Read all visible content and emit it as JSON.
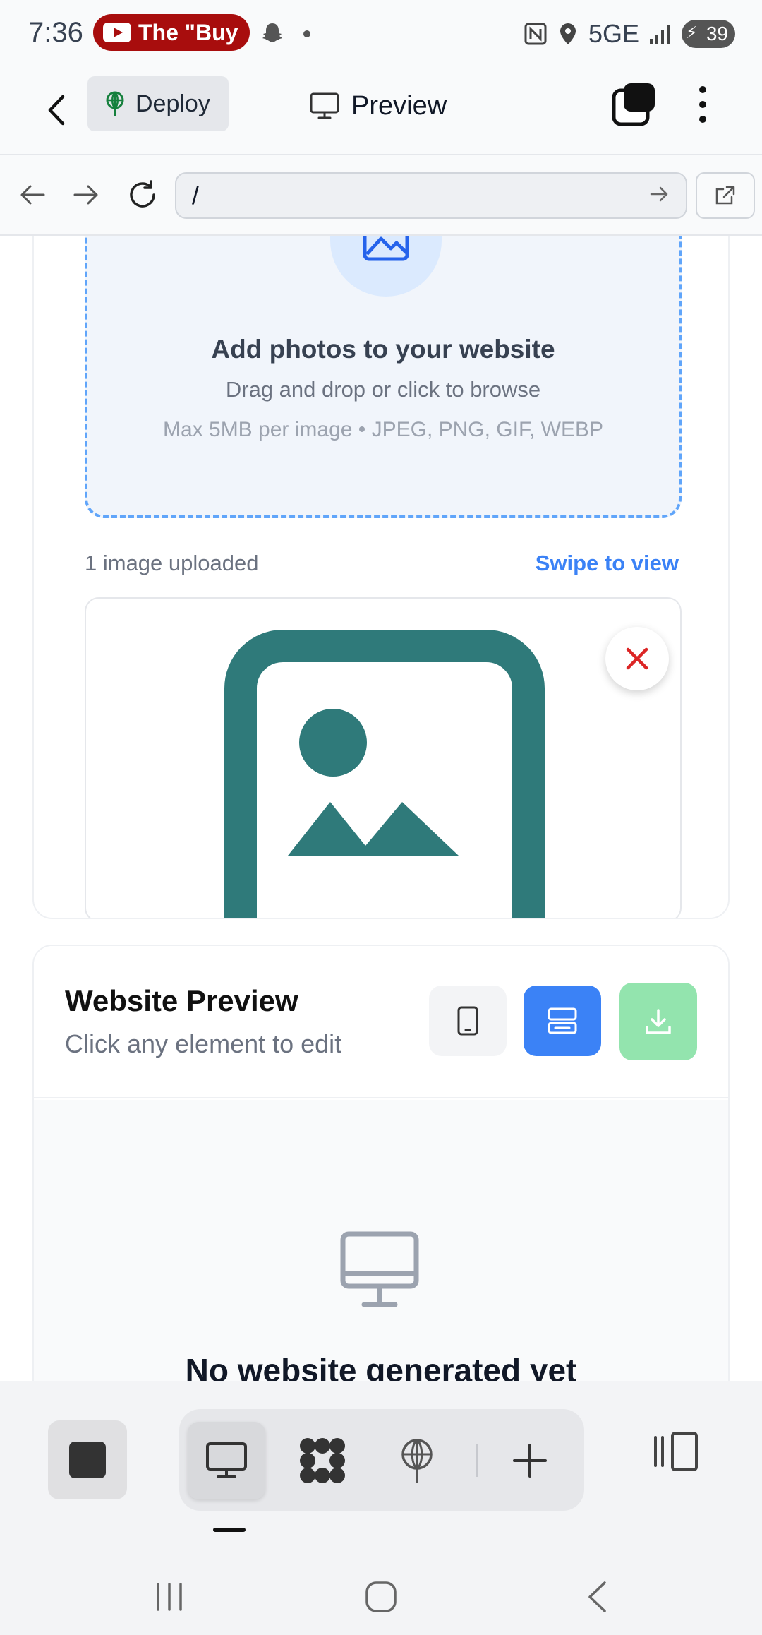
{
  "status_bar": {
    "time": "7:36",
    "notification_text": "The \"Buy",
    "network": "5GE",
    "battery": "39"
  },
  "header": {
    "deploy_label": "Deploy",
    "title": "Preview"
  },
  "url_bar": {
    "url": "/"
  },
  "upload": {
    "title": "Add photos to your website",
    "subtitle": "Drag and drop or click to browse",
    "hint": "Max 5MB per image • JPEG, PNG, GIF, WEBP",
    "count_text": "1 image uploaded",
    "swipe_label": "Swipe to view"
  },
  "website_preview": {
    "title": "Website Preview",
    "subtitle": "Click any element to edit",
    "empty_text": "No website generated yet"
  },
  "colors": {
    "accent": "#3b82f6",
    "download": "#93e4ae",
    "image_teal": "#2f7a7a",
    "remove_red": "#dc2626"
  }
}
